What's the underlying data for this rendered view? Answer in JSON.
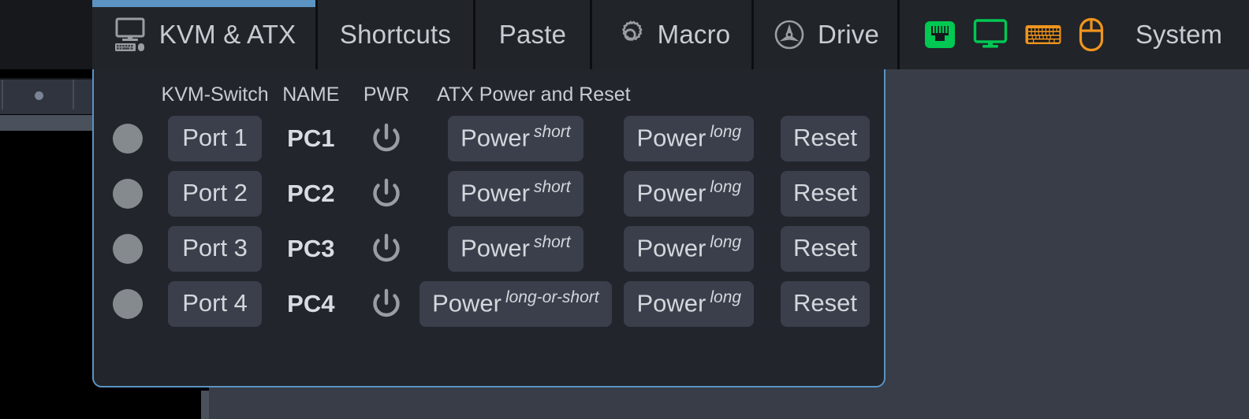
{
  "colors": {
    "accent_blue": "#5b93c2",
    "panel_bg": "#22252b",
    "tab_bg": "#212429",
    "button_bg": "#3a3f4b",
    "text": "#c8ccd2",
    "led_gray": "#858a8f",
    "status_green": "#00c853",
    "status_orange": "#f0951e",
    "remote_bg": "#383d48"
  },
  "tabbar": {
    "tabs": [
      {
        "label": "KVM & ATX",
        "icon": "monitor-keyboard-mouse-icon",
        "active": true
      },
      {
        "label": "Shortcuts",
        "icon": "",
        "active": false
      },
      {
        "label": "Paste",
        "icon": "",
        "active": false
      },
      {
        "label": "Macro",
        "icon": "gear-icon",
        "active": false
      },
      {
        "label": "Drive",
        "icon": "disc-drive-icon",
        "active": false
      }
    ],
    "status_icons": [
      {
        "name": "network-port-icon",
        "color": "#00c853"
      },
      {
        "name": "monitor-icon",
        "color": "#00c853"
      },
      {
        "name": "keyboard-icon",
        "color": "#f0951e"
      },
      {
        "name": "mouse-icon",
        "color": "#f0951e"
      }
    ],
    "system_label": "System"
  },
  "kvm_panel": {
    "headers": {
      "switch": "KVM-Switch",
      "name": "NAME",
      "pwr": "PWR",
      "atx": "ATX Power and Reset"
    },
    "rows": [
      {
        "led": "off",
        "port_label": "Port 1",
        "pc_name": "PC1",
        "pwr_icon": "power-icon",
        "power_short_label": "Power",
        "power_short_sup": "short",
        "power_long_label": "Power",
        "power_long_sup": "long",
        "reset_label": "Reset"
      },
      {
        "led": "off",
        "port_label": "Port 2",
        "pc_name": "PC2",
        "pwr_icon": "power-icon",
        "power_short_label": "Power",
        "power_short_sup": "short",
        "power_long_label": "Power",
        "power_long_sup": "long",
        "reset_label": "Reset"
      },
      {
        "led": "off",
        "port_label": "Port 3",
        "pc_name": "PC3",
        "pwr_icon": "power-icon",
        "power_short_label": "Power",
        "power_short_sup": "short",
        "power_long_label": "Power",
        "power_long_sup": "long",
        "reset_label": "Reset"
      },
      {
        "led": "off",
        "port_label": "Port 4",
        "pc_name": "PC4",
        "pwr_icon": "power-icon",
        "power_short_label": "Power",
        "power_short_sup": "long-or-short",
        "power_long_label": "Power",
        "power_long_sup": "long",
        "reset_label": "Reset"
      }
    ]
  }
}
